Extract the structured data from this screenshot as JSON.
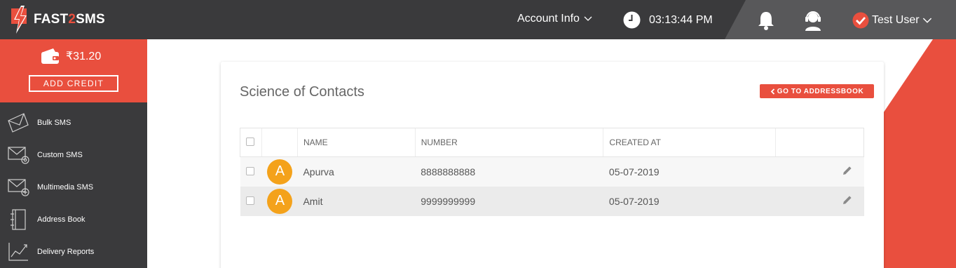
{
  "brand": {
    "name_prefix": "FAST",
    "name_mid": "2",
    "name_suffix": "SMS",
    "accent": "#e94f3e"
  },
  "header": {
    "account_info": "Account Info",
    "time": "03:13:44 PM",
    "user_name": "Test User",
    "icons": [
      "clock-icon",
      "bell-icon",
      "support-headset-icon",
      "verified-check-icon"
    ]
  },
  "wallet": {
    "balance": "₹31.20",
    "add_credit": "ADD CREDIT"
  },
  "sidebar": {
    "items": [
      {
        "label": "Bulk SMS",
        "icon": "envelope-icon"
      },
      {
        "label": "Custom SMS",
        "icon": "envelope-gear-icon"
      },
      {
        "label": "Multimedia SMS",
        "icon": "envelope-plus-icon"
      },
      {
        "label": "Address Book",
        "icon": "notebook-icon"
      },
      {
        "label": "Delivery Reports",
        "icon": "chart-report-icon"
      }
    ]
  },
  "main": {
    "title": "Science of Contacts",
    "back_button": "GO TO ADDRESSBOOK",
    "columns": [
      "NAME",
      "NUMBER",
      "CREATED AT"
    ],
    "rows": [
      {
        "initial": "A",
        "name": "Apurva",
        "number": "8888888888",
        "created_at": "05-07-2019"
      },
      {
        "initial": "A",
        "name": "Amit",
        "number": "9999999999",
        "created_at": "05-07-2019"
      }
    ]
  }
}
